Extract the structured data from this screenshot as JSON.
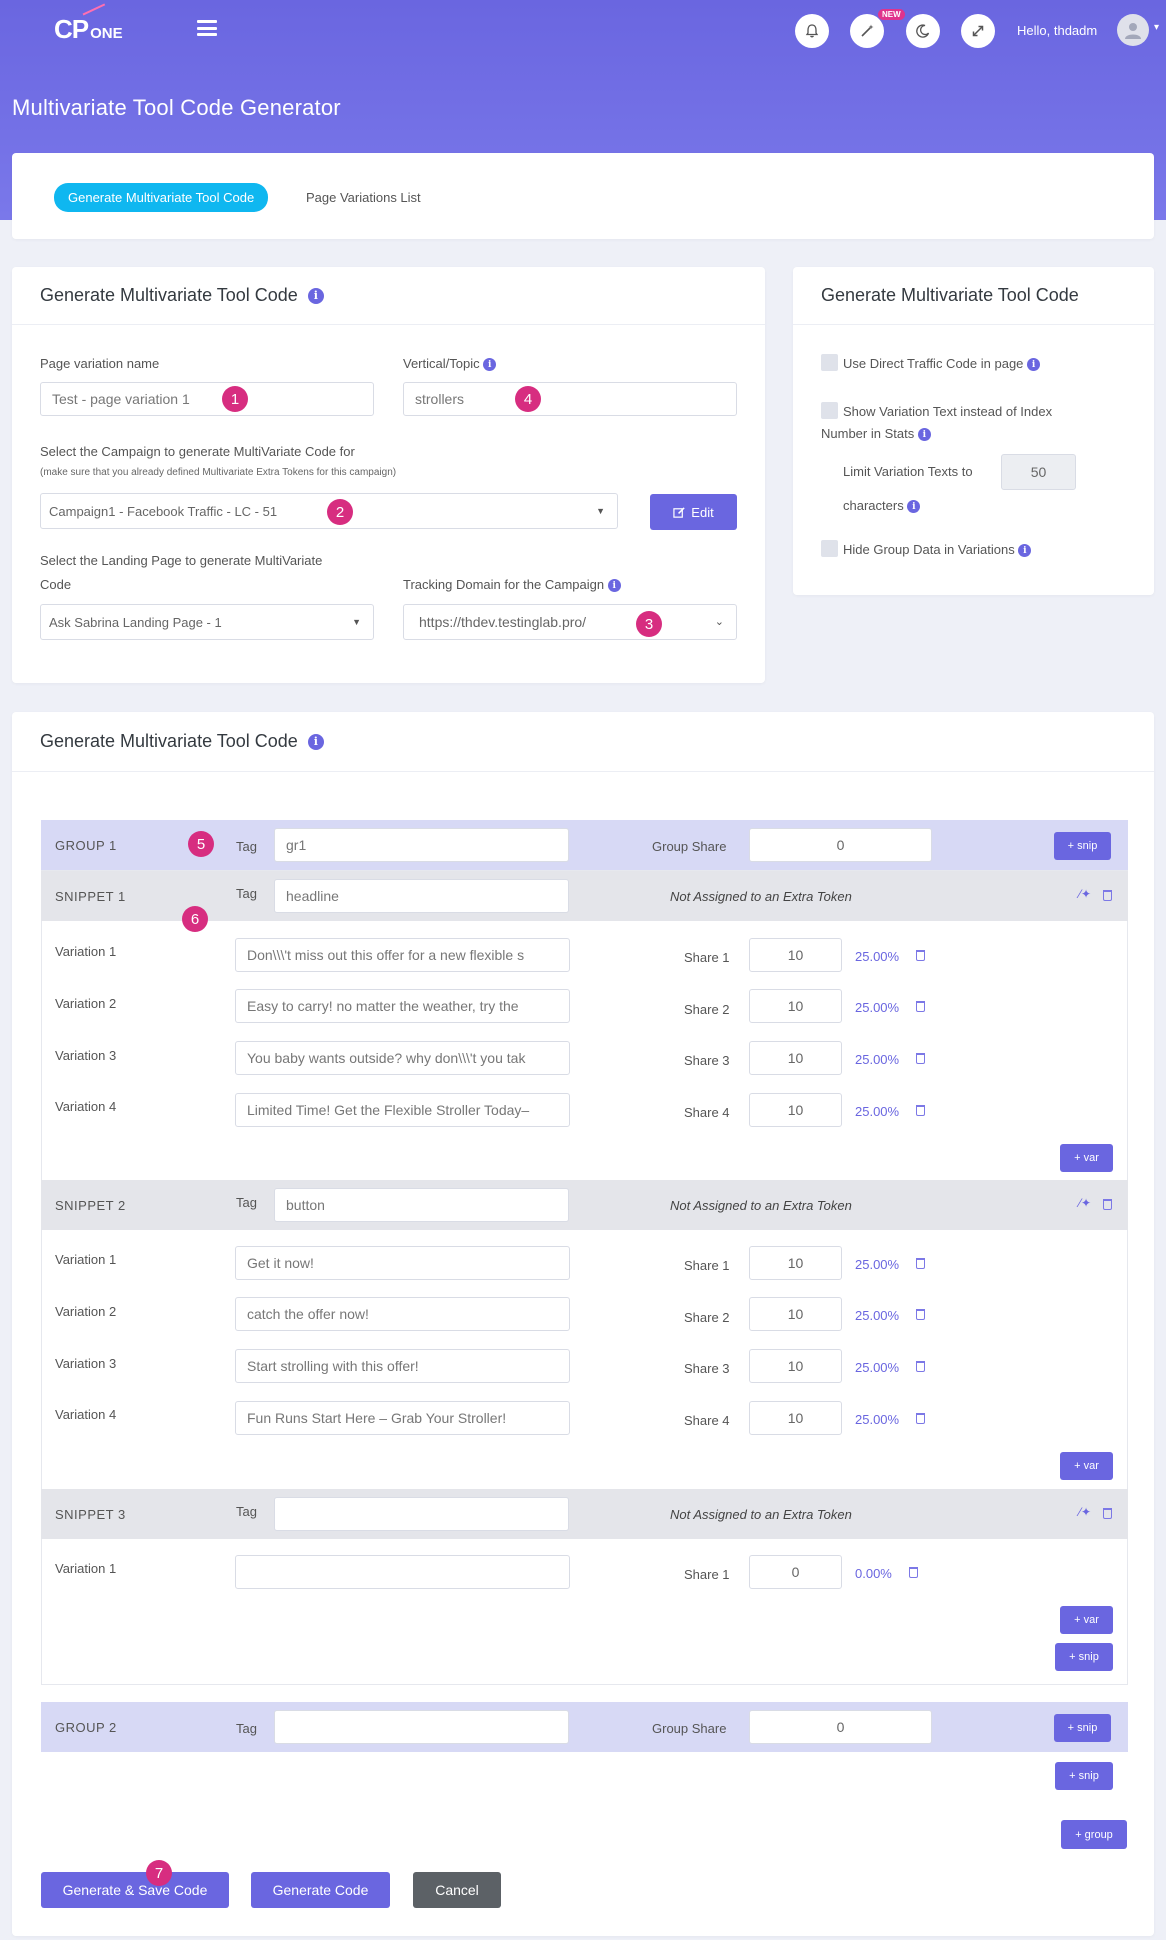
{
  "header": {
    "logo_text": "CP",
    "logo_suffix": "ONE",
    "new_badge": "NEW",
    "greeting": "Hello, thdadm"
  },
  "page_title": "Multivariate Tool Code Generator",
  "tabs": {
    "active": "Generate Multivariate Tool Code",
    "other": "Page Variations List"
  },
  "form_card": {
    "title": "Generate Multivariate Tool Code",
    "page_variation_label": "Page variation name",
    "page_variation_value": "Test - page variation 1",
    "vertical_label": "Vertical/Topic",
    "vertical_value": "strollers",
    "campaign_label": "Select the Campaign to generate MultiVariate Code for",
    "campaign_note": "(make sure that you already defined Multivariate Extra Tokens for this campaign)",
    "campaign_value": "Campaign1 - Facebook Traffic  -  LC  -  51",
    "edit_button": "Edit",
    "landing_label_1": "Select the Landing Page to generate MultiVariate",
    "landing_label_2": "Code",
    "landing_value": "Ask Sabrina Landing Page - 1",
    "tracking_label": "Tracking Domain for the Campaign",
    "tracking_value": "https://thdev.testinglab.pro/"
  },
  "options_card": {
    "title": "Generate Multivariate Tool Code",
    "direct_traffic": "Use Direct Traffic Code in page",
    "show_variation_1": "Show Variation Text instead of Index",
    "show_variation_2": "Number in Stats",
    "limit_label": "Limit Variation Texts to",
    "limit_value": "50",
    "characters": "characters",
    "hide_group": "Hide Group Data in Variations"
  },
  "markers": [
    "1",
    "2",
    "3",
    "4",
    "5",
    "6",
    "7"
  ],
  "builder": {
    "title": "Generate Multivariate Tool Code",
    "tag_label": "Tag",
    "group_share_label": "Group Share",
    "not_assigned": "Not Assigned to an Extra Token",
    "snip_btn": "+ snip",
    "var_btn": "+ var",
    "group_btn": "+ group",
    "group1": {
      "label": "GROUP 1",
      "tag": "gr1",
      "share": "0"
    },
    "group2": {
      "label": "GROUP 2",
      "tag": "",
      "share": "0"
    },
    "snippets": [
      {
        "label": "SNIPPET 1",
        "tag_placeholder": "headline",
        "variations": [
          {
            "label": "Variation 1",
            "text": "Don\\\\\\'t miss out this offer for a new flexible s",
            "share_label": "Share 1",
            "share": "10",
            "pct": "25.00%"
          },
          {
            "label": "Variation 2",
            "text": "Easy to carry! no matter the weather, try the",
            "share_label": "Share 2",
            "share": "10",
            "pct": "25.00%"
          },
          {
            "label": "Variation 3",
            "text": "You baby wants outside? why don\\\\\\'t you tak",
            "share_label": "Share 3",
            "share": "10",
            "pct": "25.00%"
          },
          {
            "label": "Variation 4",
            "text": "Limited Time! Get the Flexible Stroller Today–",
            "share_label": "Share 4",
            "share": "10",
            "pct": "25.00%"
          }
        ]
      },
      {
        "label": "SNIPPET 2",
        "tag_placeholder": "button",
        "variations": [
          {
            "label": "Variation 1",
            "text": "Get it now!",
            "share_label": "Share 1",
            "share": "10",
            "pct": "25.00%"
          },
          {
            "label": "Variation 2",
            "text": "catch the offer now!",
            "share_label": "Share 2",
            "share": "10",
            "pct": "25.00%"
          },
          {
            "label": "Variation 3",
            "text": "Start strolling with this offer!",
            "share_label": "Share 3",
            "share": "10",
            "pct": "25.00%"
          },
          {
            "label": "Variation 4",
            "text": "Fun Runs Start Here – Grab Your Stroller!",
            "share_label": "Share 4",
            "share": "10",
            "pct": "25.00%"
          }
        ]
      },
      {
        "label": "SNIPPET 3",
        "tag_placeholder": "",
        "variations": [
          {
            "label": "Variation 1",
            "text": "",
            "share_label": "Share 1",
            "share": "0",
            "pct": "0.00%"
          }
        ]
      }
    ]
  },
  "actions": {
    "save": "Generate & Save Code",
    "generate": "Generate Code",
    "cancel": "Cancel"
  },
  "colors": {
    "primary": "#6a66e0",
    "accent_blue": "#0fb7f0",
    "marker": "#d72d80",
    "cancel": "#5c6166"
  }
}
